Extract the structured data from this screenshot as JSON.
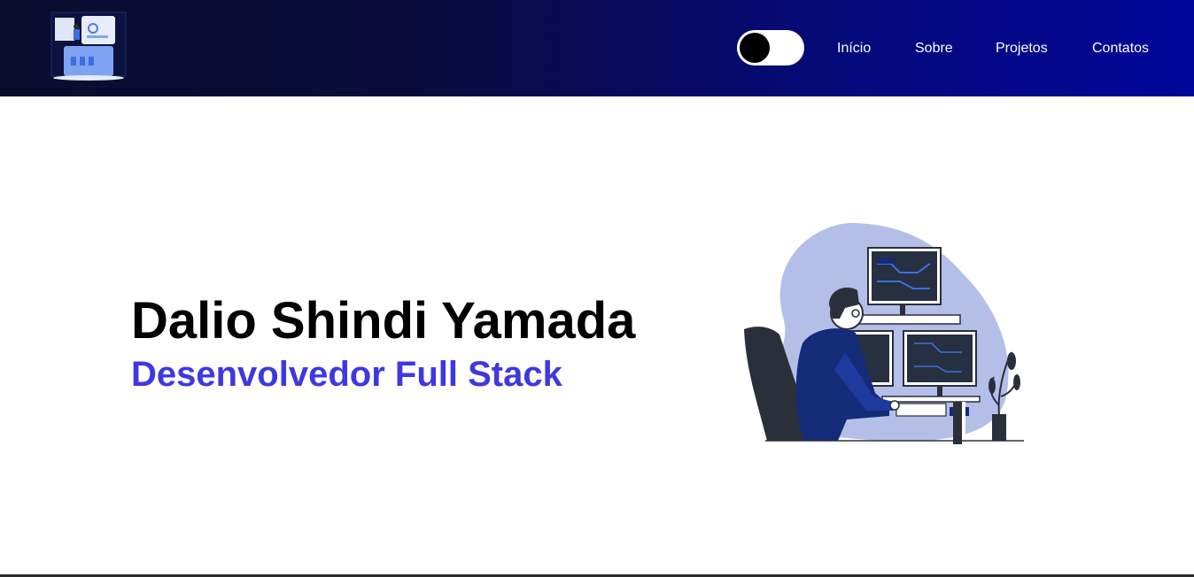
{
  "header": {
    "logo_icon": "developer-workspace-logo",
    "theme_toggle": {
      "state": "off",
      "icon": "toggle-icon"
    },
    "nav": [
      {
        "label": "Início"
      },
      {
        "label": "Sobre"
      },
      {
        "label": "Projetos"
      },
      {
        "label": "Contatos"
      }
    ]
  },
  "hero": {
    "name": "Dalio Shindi Yamada",
    "role": "Desenvolvedor Full Stack",
    "illustration_icon": "developer-at-computer-illustration"
  },
  "colors": {
    "header_gradient_start": "#0b0d2e",
    "header_gradient_end": "#02069a",
    "accent": "#3f38e0",
    "illustration_blob": "#b4bfe8",
    "illustration_navy": "#142b7a"
  }
}
